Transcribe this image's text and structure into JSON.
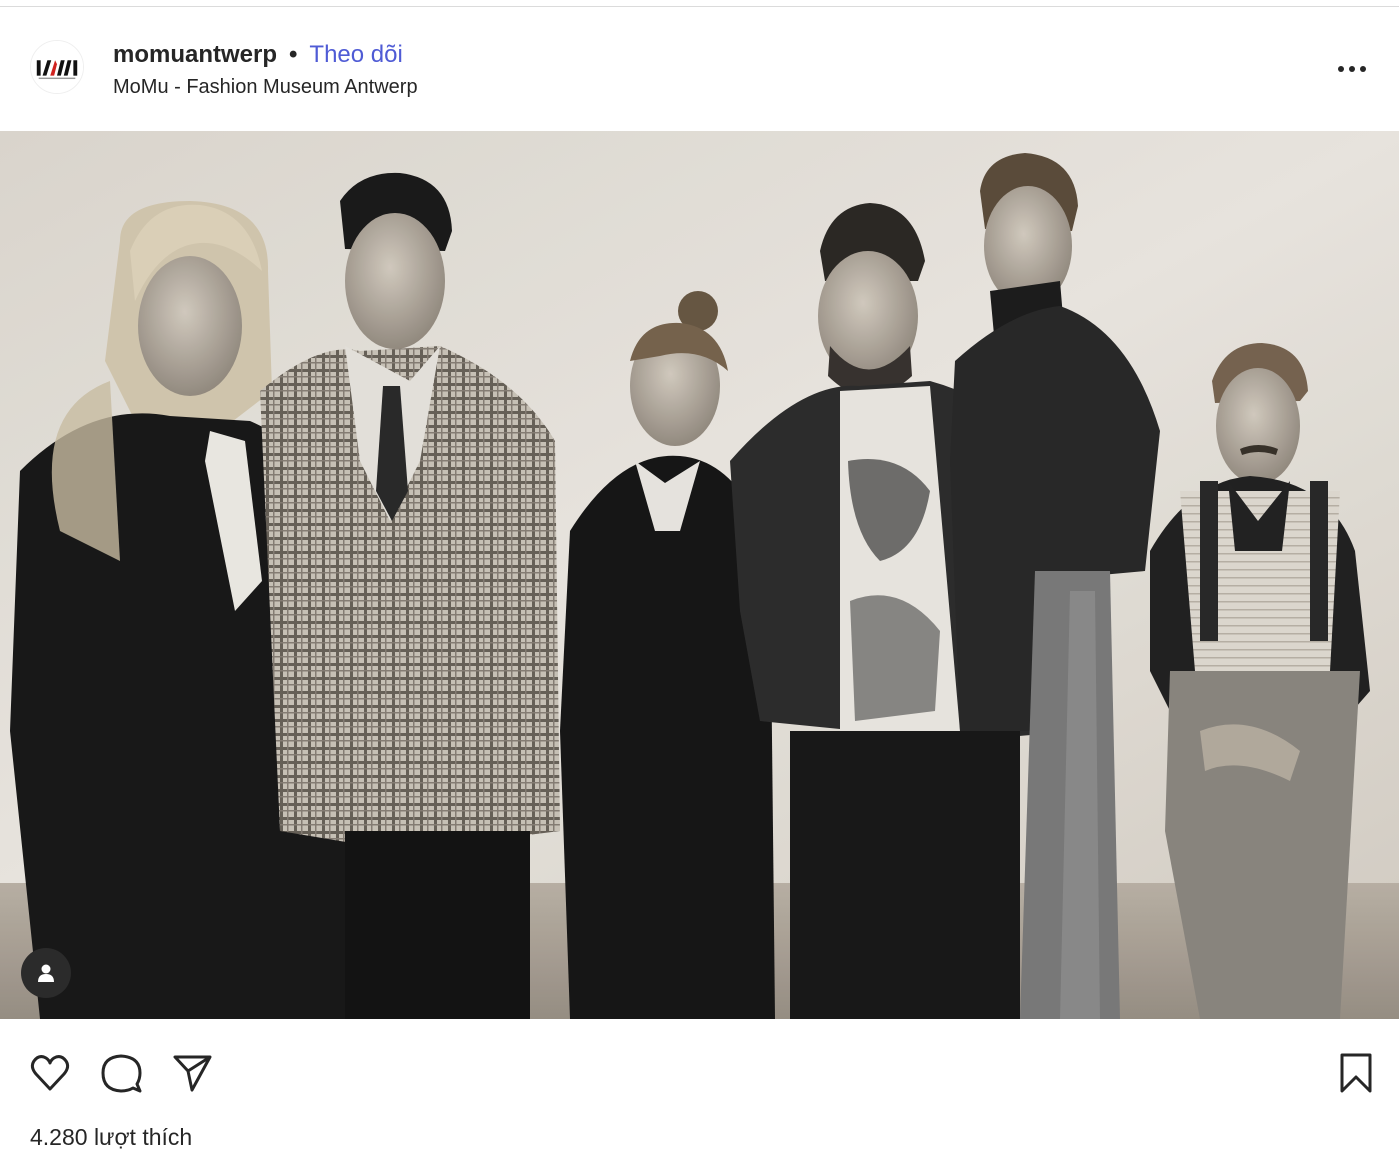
{
  "post": {
    "username": "momuantwerp",
    "separator": "•",
    "follow_label": "Theo dõi",
    "location": "MoMu - Fashion Museum Antwerp",
    "likes_text": "4.280 lượt thích"
  },
  "icons": {
    "avatar": "momu-logo",
    "more": "more-horizontal-icon",
    "tag": "user-tag-icon",
    "like": "heart-icon",
    "comment": "comment-icon",
    "share": "share-icon",
    "save": "bookmark-icon"
  },
  "colors": {
    "follow": "#4f5bd5",
    "text": "#262626",
    "logo_red": "#d0221f"
  }
}
